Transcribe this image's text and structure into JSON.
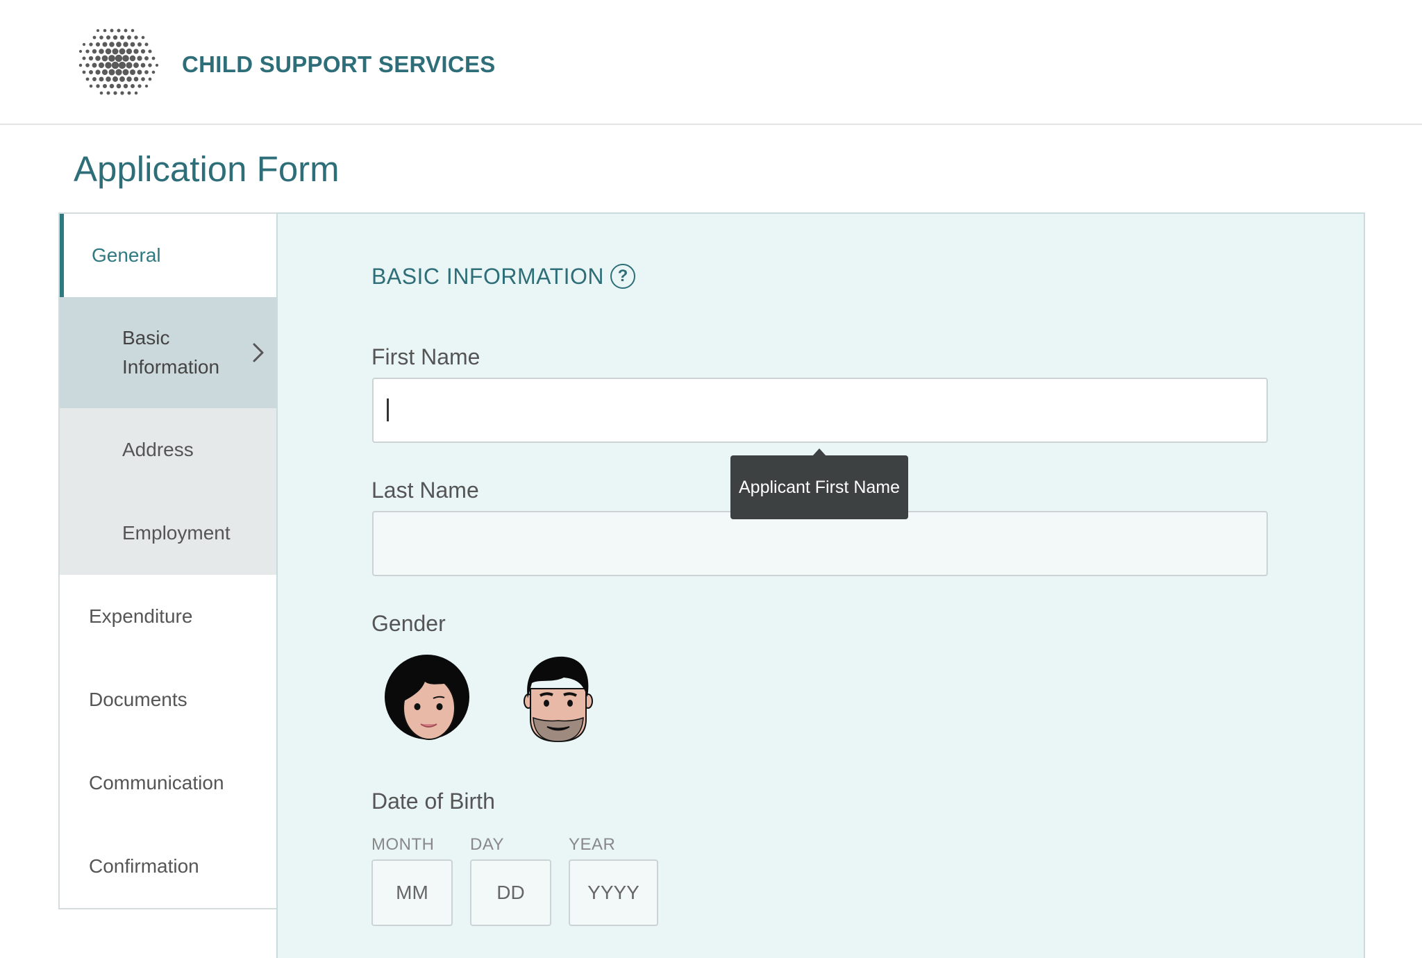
{
  "header": {
    "brand": "CHILD SUPPORT SERVICES"
  },
  "page": {
    "title": "Application Form"
  },
  "nav": {
    "general": "General",
    "basic_line1": "Basic",
    "basic_line2": "Information",
    "address": "Address",
    "employment": "Employment",
    "expenditure": "Expenditure",
    "documents": "Documents",
    "communication": "Communication",
    "confirmation": "Confirmation"
  },
  "form": {
    "section_title": "BASIC INFORMATION",
    "help_symbol": "?",
    "first_name_label": "First Name",
    "first_name_value": "",
    "last_name_label": "Last Name",
    "last_name_value": "",
    "tooltip": "Applicant First Name",
    "gender_label": "Gender",
    "dob_label": "Date of Birth",
    "dob": {
      "month_caption": "MONTH",
      "day_caption": "DAY",
      "year_caption": "YEAR",
      "month_placeholder": "MM",
      "day_placeholder": "DD",
      "year_placeholder": "YYYY"
    }
  },
  "colors": {
    "accent": "#2e6e78",
    "panel_bg": "#eaf5f5",
    "nav_selected": "#ccd9dc",
    "nav_sub": "#e5e9ea",
    "tooltip_bg": "#3e4142"
  },
  "icons": [
    "logo-dots-icon",
    "help-icon",
    "chevron-right-icon",
    "female-avatar-icon",
    "male-avatar-icon"
  ]
}
